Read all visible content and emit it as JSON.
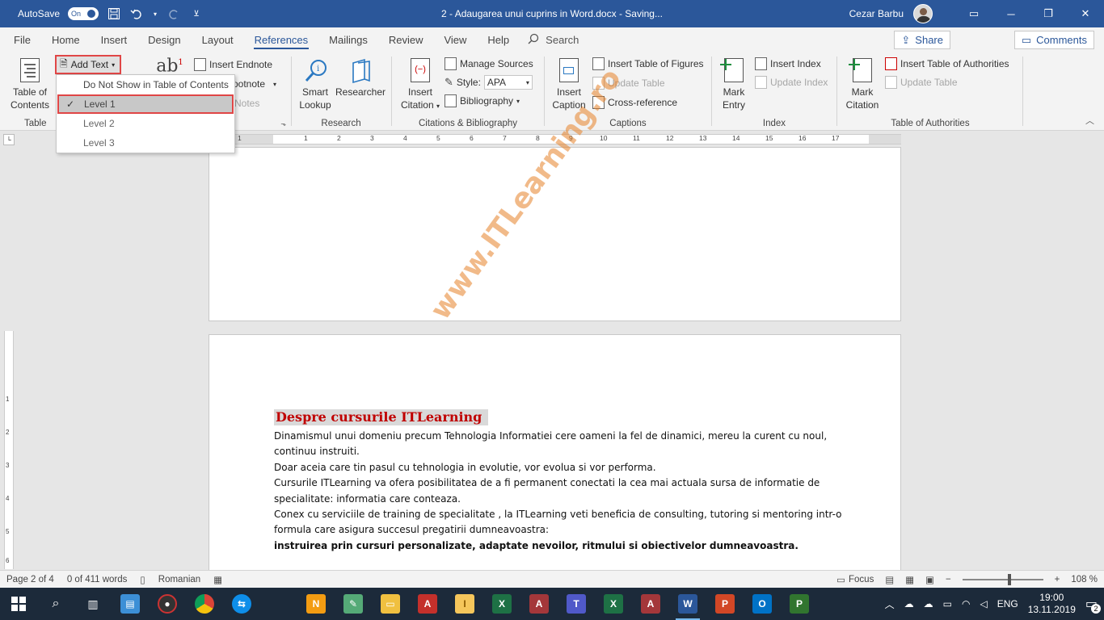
{
  "titlebar": {
    "autosave_label": "AutoSave",
    "autosave_state": "On",
    "doc_title": "2 - Adaugarea unui cuprins in Word.docx  -  Saving...",
    "user_name": "Cezar Barbu"
  },
  "menu": {
    "tabs": [
      "File",
      "Home",
      "Insert",
      "Design",
      "Layout",
      "References",
      "Mailings",
      "Review",
      "View",
      "Help"
    ],
    "active_tab": "References",
    "search_label": "Search",
    "share_label": "Share",
    "comments_label": "Comments"
  },
  "ribbon": {
    "toc": {
      "button_line1": "Table of",
      "button_line2": "Contents",
      "group_label": "Table",
      "add_text_label": "Add Text"
    },
    "footnotes": {
      "insert_endnote": "Insert Endnote",
      "next_footnote": "ootnote",
      "show_notes": "Notes"
    },
    "research": {
      "smart_lookup_1": "Smart",
      "smart_lookup_2": "Lookup",
      "researcher": "Researcher",
      "group_label": "Research"
    },
    "citations": {
      "insert_citation_1": "Insert",
      "insert_citation_2": "Citation",
      "manage_sources": "Manage Sources",
      "style_label": "Style:",
      "style_value": "APA",
      "bibliography": "Bibliography",
      "group_label": "Citations & Bibliography"
    },
    "captions": {
      "insert_caption_1": "Insert",
      "insert_caption_2": "Caption",
      "insert_table_of_figures": "Insert Table of Figures",
      "update_table": "Update Table",
      "cross_reference": "Cross-reference",
      "group_label": "Captions"
    },
    "index": {
      "mark_entry_1": "Mark",
      "mark_entry_2": "Entry",
      "insert_index": "Insert Index",
      "update_index": "Update Index",
      "group_label": "Index"
    },
    "authorities": {
      "mark_citation_1": "Mark",
      "mark_citation_2": "Citation",
      "insert_table_of_authorities": "Insert Table of Authorities",
      "update_table": "Update Table",
      "group_label": "Table of Authorities"
    }
  },
  "dropdown": {
    "items": [
      "Do Not Show in Table of Contents",
      "Level 1",
      "Level 2",
      "Level 3"
    ],
    "checked": "Level 1"
  },
  "ruler": {
    "numbers": [
      "1",
      "1",
      "2",
      "3",
      "4",
      "5",
      "6",
      "7",
      "8",
      "9",
      "10",
      "11",
      "12",
      "13",
      "14",
      "15",
      "16",
      "17"
    ],
    "vnumbers": [
      "1",
      "2",
      "3",
      "4",
      "5",
      "6"
    ]
  },
  "document": {
    "heading": "Despre cursurile ITLearning",
    "paragraphs": [
      "Dinamismul unui domeniu precum Tehnologia Informatiei cere oameni la fel de dinamici, mereu la curent cu noul, continuu instruiti.",
      "Doar aceia care tin pasul cu tehnologia in evolutie, vor evolua si vor performa.",
      "Cursurile ITLearning va ofera posibilitatea de a fi permanent conectati la cea mai actuala sursa de informatie de specialitate: informatia care conteaza.",
      "Conex cu serviciile de training de specialitate , la ITLearning veti beneficia de consulting, tutoring si mentoring intr-o formula care asigura succesul pregatirii dumneavoastra:"
    ],
    "bold_paragraph": "instruirea prin cursuri personalizate, adaptate nevoilor, ritmului si obiectivelor dumneavoastra.",
    "watermark": "www.ITLearning.ro"
  },
  "statusbar": {
    "page": "Page 2 of 4",
    "words": "0 of 411 words",
    "language": "Romanian",
    "focus": "Focus",
    "zoom": "108 %"
  },
  "taskbar": {
    "lang": "ENG",
    "time": "19:00",
    "date": "13.11.2019",
    "notifications": "2"
  },
  "colors": {
    "word_blue": "#2b579a",
    "highlight_red": "#e04646",
    "heading_red": "#c00000"
  }
}
